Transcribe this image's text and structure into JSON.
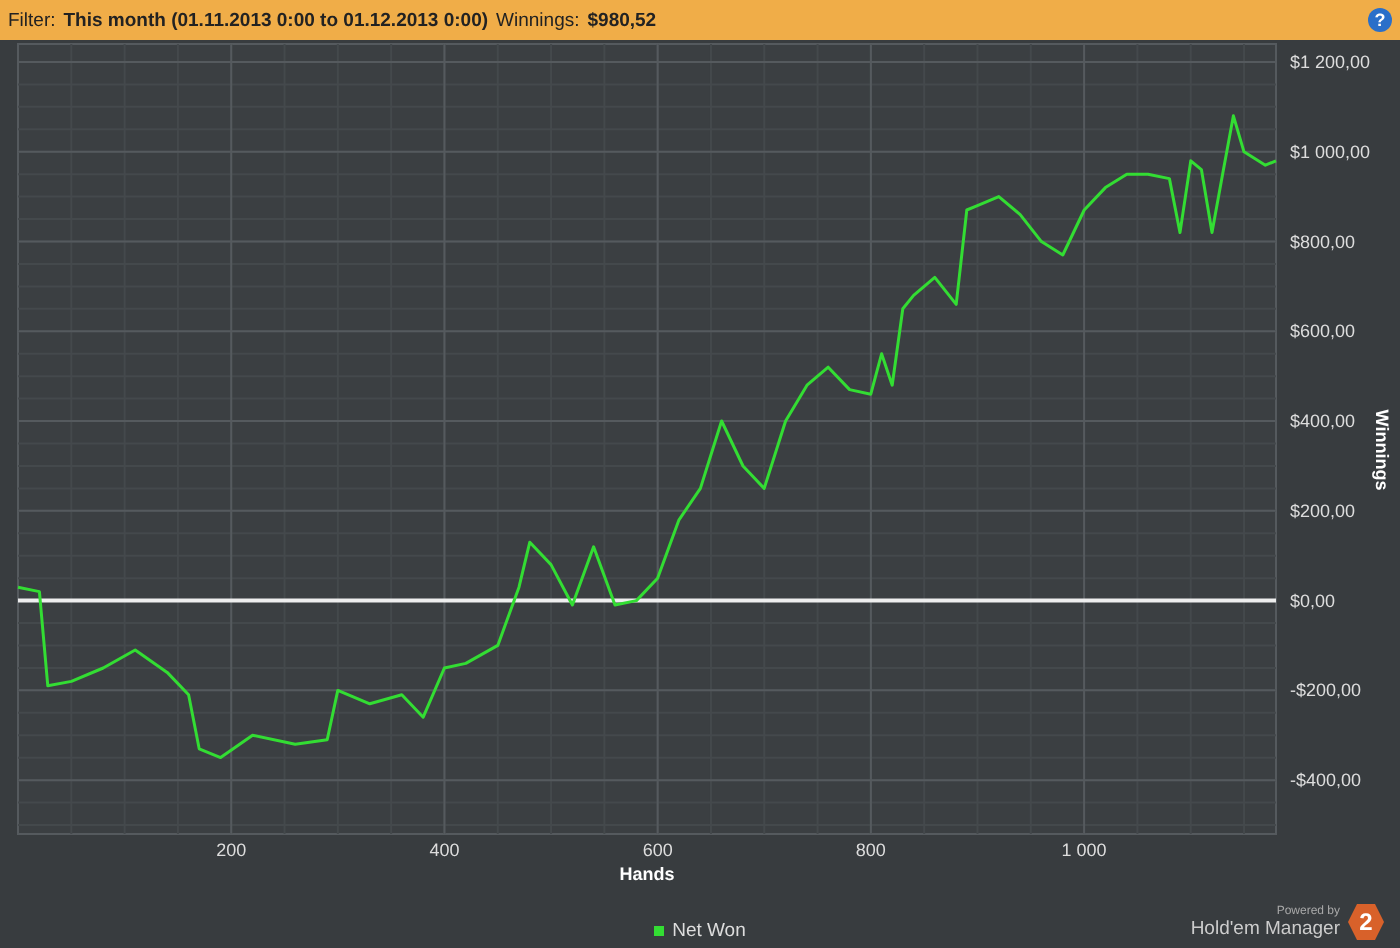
{
  "filter_bar": {
    "label": "Filter:",
    "filter": "This month (01.11.2013 0:00 to 01.12.2013 0:00)",
    "winnings_label": "Winnings:",
    "winnings": "$980,52",
    "help": "?"
  },
  "chart": {
    "chart_data": {
      "type": "line",
      "xlabel": "Hands",
      "ylabel": "Winnings",
      "xlim": [
        0,
        1180
      ],
      "ylim": [
        -520,
        1240
      ],
      "xticks": [
        200,
        400,
        600,
        800,
        {
          "value": 1000,
          "label": "1 000"
        }
      ],
      "yticks": [
        {
          "value": -400,
          "label": "-$400,00"
        },
        {
          "value": -200,
          "label": "-$200,00"
        },
        {
          "value": 0,
          "label": "$0,00"
        },
        {
          "value": 200,
          "label": "$200,00"
        },
        {
          "value": 400,
          "label": "$400,00"
        },
        {
          "value": 600,
          "label": "$600,00"
        },
        {
          "value": 800,
          "label": "$800,00"
        },
        {
          "value": 1000,
          "label": "$1 000,00"
        },
        {
          "value": 1200,
          "label": "$1 200,00"
        }
      ],
      "x": [
        0,
        20,
        28,
        50,
        80,
        110,
        140,
        160,
        170,
        190,
        220,
        260,
        290,
        300,
        330,
        360,
        380,
        400,
        420,
        450,
        470,
        480,
        500,
        520,
        540,
        560,
        580,
        600,
        620,
        640,
        660,
        680,
        700,
        720,
        740,
        760,
        780,
        800,
        810,
        820,
        830,
        840,
        860,
        880,
        890,
        900,
        920,
        940,
        960,
        980,
        1000,
        1020,
        1040,
        1060,
        1080,
        1090,
        1100,
        1110,
        1120,
        1130,
        1140,
        1150,
        1170,
        1180
      ],
      "series": [
        {
          "name": "Net Won",
          "color": "#33dd33",
          "values": [
            30,
            20,
            -190,
            -180,
            -150,
            -110,
            -160,
            -210,
            -330,
            -350,
            -300,
            -320,
            -310,
            -200,
            -230,
            -210,
            -260,
            -150,
            -140,
            -100,
            30,
            130,
            80,
            -10,
            120,
            -10,
            0,
            50,
            180,
            250,
            400,
            300,
            250,
            400,
            480,
            520,
            470,
            460,
            550,
            480,
            650,
            680,
            720,
            660,
            870,
            880,
            900,
            860,
            800,
            770,
            870,
            920,
            950,
            950,
            940,
            820,
            980,
            960,
            820,
            950,
            1080,
            1000,
            970,
            980
          ]
        }
      ],
      "grid": true,
      "ref_lines": [
        {
          "axis": "y",
          "value": 0
        }
      ]
    }
  },
  "branding": {
    "powered_by": "Powered by",
    "product": "Hold'em Manager",
    "badge": "2"
  }
}
